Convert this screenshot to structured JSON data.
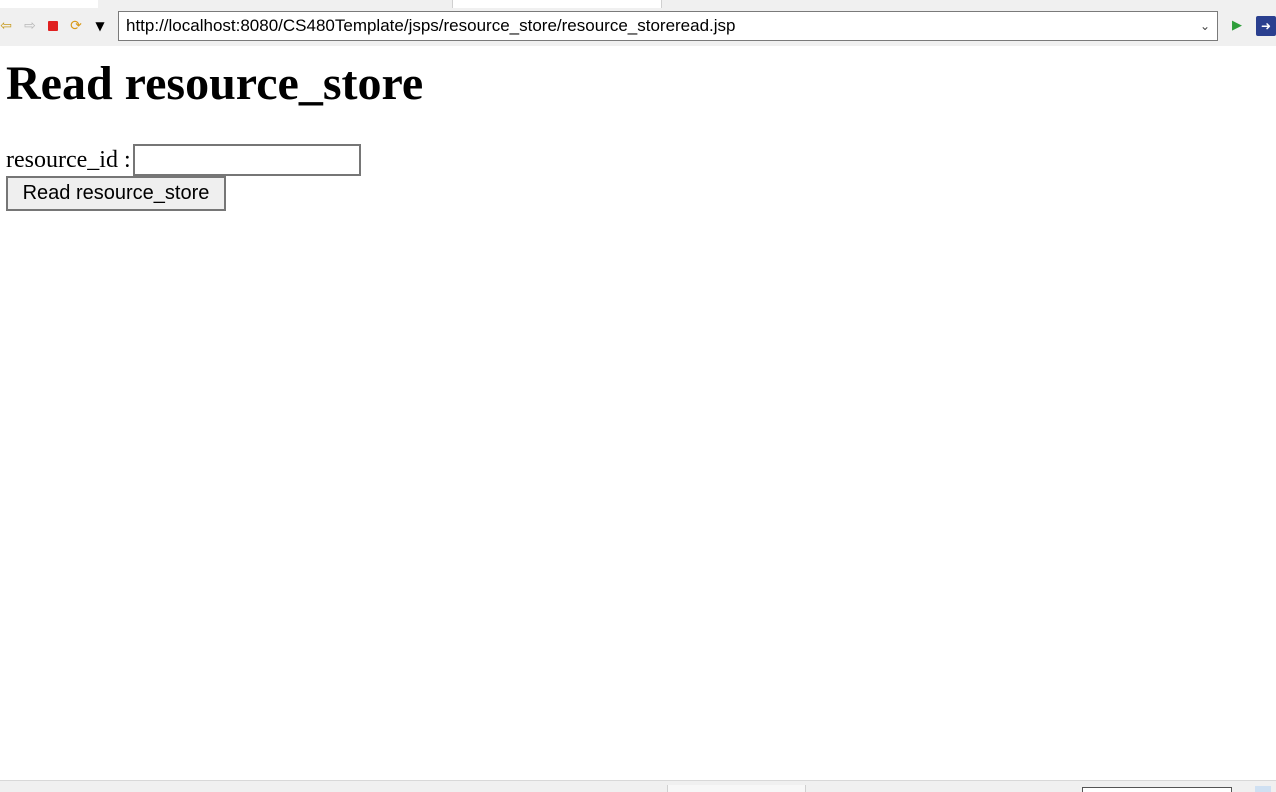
{
  "browser": {
    "url": "http://localhost:8080/CS480Template/jsps/resource_store/resource_storeread.jsp",
    "icons": {
      "back": "back-arrow-icon",
      "forward": "forward-arrow-icon",
      "stop": "stop-icon",
      "refresh": "refresh-icon",
      "menu": "menu-dropdown-icon",
      "url_dropdown": "chevron-down-icon",
      "go": "go-icon",
      "extension": "extension-icon"
    }
  },
  "page": {
    "title": "Read resource_store",
    "form": {
      "field_label": "resource_id :",
      "field_value": "",
      "submit_label": "Read resource_store"
    }
  },
  "colors": {
    "stop": "#e02020",
    "go": "#2e9e3a",
    "back": "#c79a1e",
    "refresh": "#d99a1a",
    "extension": "#2a3f8f"
  }
}
